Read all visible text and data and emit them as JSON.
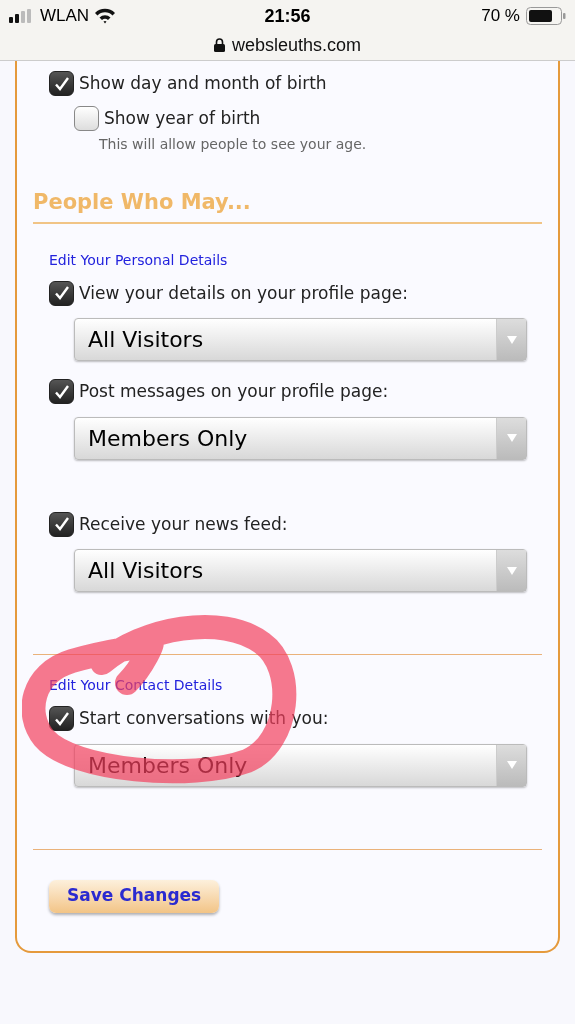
{
  "status_bar": {
    "carrier": "WLAN",
    "time": "21:56",
    "battery": "70 %"
  },
  "address_bar": {
    "url": "websleuths.com"
  },
  "birth_options": [
    {
      "label": "Show day and month of birth",
      "checked": true,
      "children": [
        {
          "label": "Show year of birth",
          "checked": false,
          "hint": "This will allow people to see your age."
        }
      ]
    }
  ],
  "section": {
    "title": "People Who May...",
    "groups": [
      {
        "link": "Edit Your Personal Details",
        "permissions": [
          {
            "label": "View your details on your profile page:",
            "checked": true,
            "value": "All Visitors"
          },
          {
            "label": "Post messages on your profile page:",
            "checked": true,
            "value": "Members Only"
          }
        ]
      },
      {
        "permissions": [
          {
            "label": "Receive your news feed:",
            "checked": true,
            "value": "All Visitors"
          }
        ]
      },
      {
        "link": "Edit Your Contact Details",
        "divider_before": true,
        "permissions": [
          {
            "label": "Start conversations with you:",
            "checked": true,
            "value": "Members Only"
          }
        ]
      }
    ]
  },
  "save_button": "Save Changes"
}
